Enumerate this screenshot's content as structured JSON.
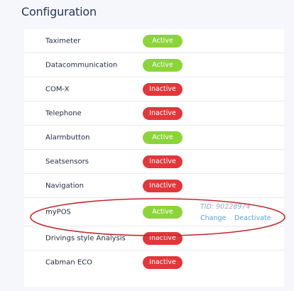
{
  "page": {
    "title": "Configuration"
  },
  "annotation": {
    "color": "#c0282d"
  },
  "rows": [
    {
      "label": "Taximeter",
      "status": "Active"
    },
    {
      "label": "Datacommunication",
      "status": "Active"
    },
    {
      "label": "COM-X",
      "status": "Inactive"
    },
    {
      "label": "Telephone",
      "status": "Inactive"
    },
    {
      "label": "Alarmbutton",
      "status": "Active"
    },
    {
      "label": "Seatsensors",
      "status": "Inactive"
    },
    {
      "label": "Navigation",
      "status": "Inactive"
    },
    {
      "label": "myPOS",
      "status": "Active",
      "tid": "TID: 90228974",
      "change_label": "Change",
      "deactivate_label": "Deactivate"
    },
    {
      "label": "Drivings style Analysis",
      "status": "Inactive"
    },
    {
      "label": "Cabman ECO",
      "status": "Inactive"
    }
  ]
}
